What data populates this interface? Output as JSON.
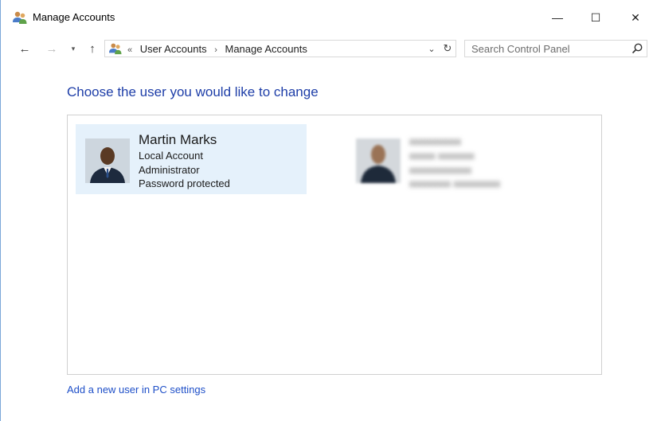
{
  "window": {
    "title": "Manage Accounts",
    "controls": {
      "minimize": "—",
      "maximize": "☐",
      "close": "✕"
    }
  },
  "navigation": {
    "back_icon": "←",
    "forward_icon": "→",
    "recent_icon": "▾",
    "up_icon": "↑",
    "breadcrumb_overflow": "«",
    "breadcrumbs": [
      "User Accounts",
      "Manage Accounts"
    ],
    "separator": "›",
    "dropdown_icon": "⌄",
    "refresh_icon": "↻",
    "search_placeholder": "Search Control Panel"
  },
  "main": {
    "heading": "Choose the user you would like to change",
    "accounts": [
      {
        "name": "Martin Marks",
        "type": "Local Account",
        "role": "Administrator",
        "status": "Password protected",
        "selected": true
      },
      {
        "name": "xxxxxxxxxx",
        "type": "xxxxx xxxxxxx",
        "role": "xxxxxxxxxxxx",
        "status": "xxxxxxxx xxxxxxxxx",
        "selected": false,
        "blurred": true
      }
    ],
    "add_user_link": "Add a new user in PC settings"
  },
  "colors": {
    "heading": "#1e3ea8",
    "link": "#1e4fc8",
    "selection": "#e5f1fb",
    "border": "#d0d0d0"
  },
  "icons": {
    "title": "users-icon",
    "address": "users-icon",
    "search": "search-icon"
  }
}
